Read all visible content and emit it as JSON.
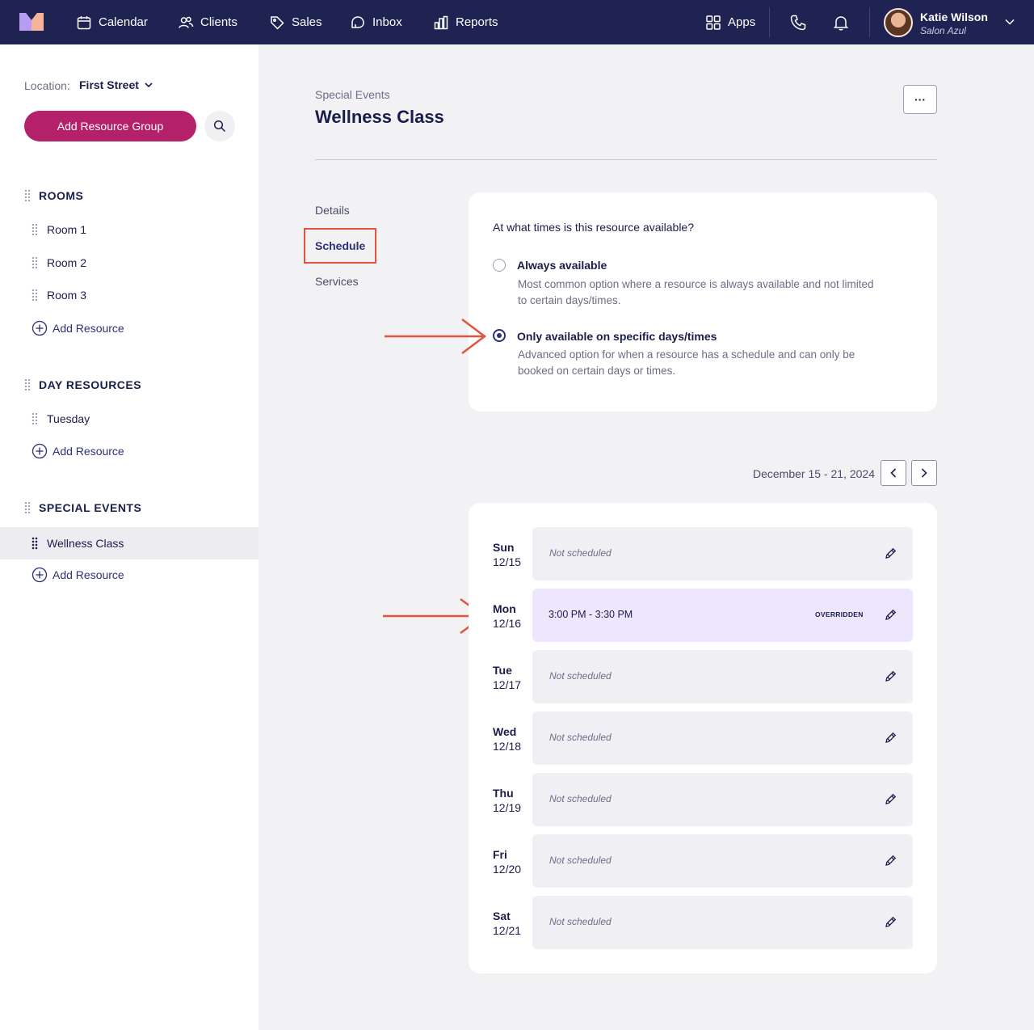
{
  "topbar": {
    "nav": [
      {
        "label": "Calendar",
        "icon": "calendar-icon"
      },
      {
        "label": "Clients",
        "icon": "clients-icon"
      },
      {
        "label": "Sales",
        "icon": "tag-icon"
      },
      {
        "label": "Inbox",
        "icon": "inbox-icon"
      },
      {
        "label": "Reports",
        "icon": "chart-icon"
      }
    ],
    "apps_label": "Apps",
    "user_name": "Katie Wilson",
    "user_salon": "Salon Azul"
  },
  "sidebar": {
    "location_label": "Location:",
    "location_value": "First Street",
    "add_group_label": "Add Resource Group",
    "groups": [
      {
        "title": "ROOMS",
        "items": [
          "Room 1",
          "Room 2",
          "Room 3"
        ],
        "add_label": "Add Resource"
      },
      {
        "title": "DAY RESOURCES",
        "items": [
          "Tuesday"
        ],
        "add_label": "Add Resource"
      },
      {
        "title": "SPECIAL EVENTS",
        "items": [
          "Wellness Class"
        ],
        "add_label": "Add Resource"
      }
    ]
  },
  "main": {
    "breadcrumb": "Special Events",
    "title": "Wellness Class",
    "more_label": "···",
    "subnav": [
      "Details",
      "Schedule",
      "Services"
    ],
    "active_subnav": "Schedule",
    "availability": {
      "question": "At what times is this resource available?",
      "options": [
        {
          "title": "Always available",
          "desc": "Most common option where a resource is always available and not limited to certain days/times.",
          "checked": false
        },
        {
          "title": "Only available on specific days/times",
          "desc": "Advanced option for when a resource has a schedule and can only be booked on certain days or times.",
          "checked": true
        }
      ]
    },
    "date_range": "December 15 - 21, 2024",
    "days": [
      {
        "day": "Sun",
        "date": "12/15",
        "slot": "Not scheduled",
        "badge": ""
      },
      {
        "day": "Mon",
        "date": "12/16",
        "slot": "3:00 PM - 3:30 PM",
        "badge": "OVERRIDDEN"
      },
      {
        "day": "Tue",
        "date": "12/17",
        "slot": "Not scheduled",
        "badge": ""
      },
      {
        "day": "Wed",
        "date": "12/18",
        "slot": "Not scheduled",
        "badge": ""
      },
      {
        "day": "Thu",
        "date": "12/19",
        "slot": "Not scheduled",
        "badge": ""
      },
      {
        "day": "Fri",
        "date": "12/20",
        "slot": "Not scheduled",
        "badge": ""
      },
      {
        "day": "Sat",
        "date": "12/21",
        "slot": "Not scheduled",
        "badge": ""
      }
    ]
  },
  "colors": {
    "nav_bg": "#1f2352",
    "brand_button": "#b5206b",
    "accent": "#2d3078",
    "annotation_red": "#e4533e",
    "override_bg": "#ede6fc"
  }
}
